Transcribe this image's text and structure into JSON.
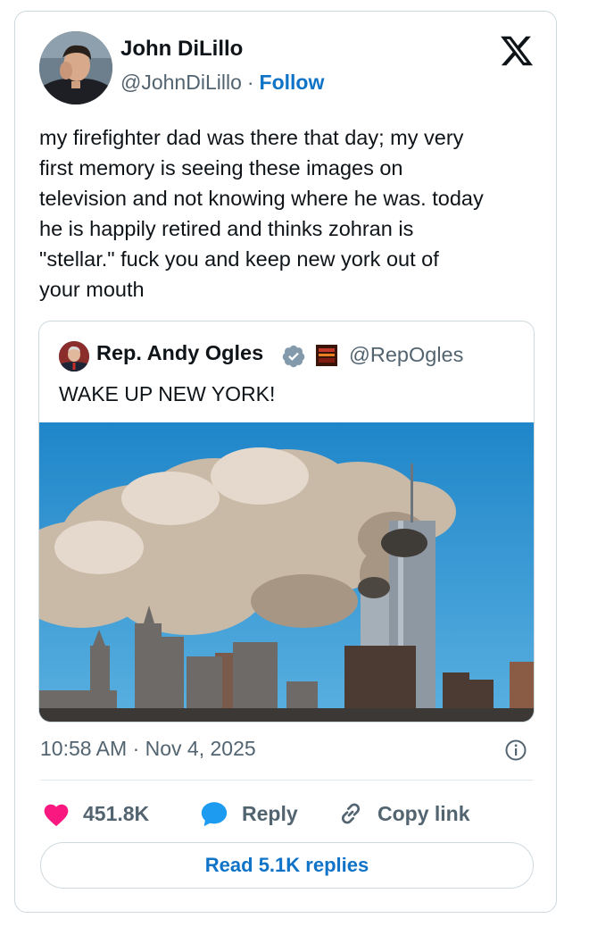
{
  "author": {
    "name": "John DiLillo",
    "handle": "@JohnDiLillo",
    "separator": "·",
    "follow_label": "Follow"
  },
  "tweet": {
    "text": "my firefighter dad was there that day; my very\nfirst memory is seeing these images on\ntelevision and not knowing where he was. today\nhe is happily retired and thinks zohran is\n\"stellar.\" fuck you and keep new york out of\nyour mouth",
    "timestamp": "10:58 AM · Nov 4, 2025"
  },
  "quoted_tweet": {
    "name": "Rep. Andy Ogles",
    "handle": "@RepOgles",
    "text": "WAKE UP NEW YORK!"
  },
  "actions": {
    "like_count": "451.8K",
    "reply_label": "Reply",
    "copy_label": "Copy link",
    "read_replies_label": "Read 5.1K replies"
  },
  "colors": {
    "accent": "#0f73c7",
    "like": "#f91880",
    "reply_icon": "#1d9bf0",
    "verified": "#829aab",
    "border": "#cfd9de"
  },
  "icons": {
    "brand": "x-logo-icon",
    "verified": "verified-badge-icon",
    "like": "heart-icon",
    "reply": "speech-bubble-icon",
    "copy": "link-icon",
    "info": "info-icon"
  }
}
